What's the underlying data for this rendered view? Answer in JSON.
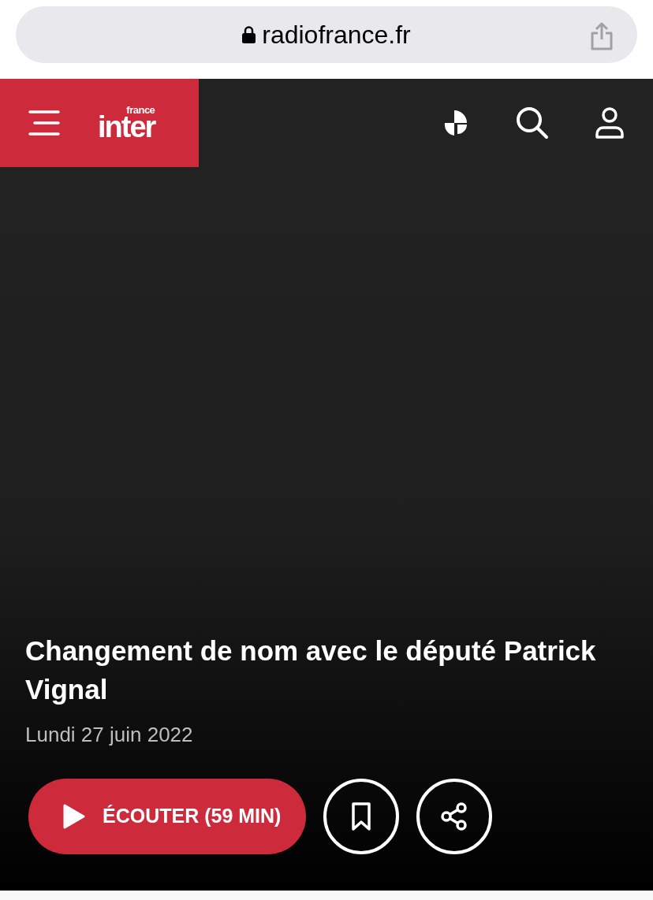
{
  "browser": {
    "url": "radiofrance.fr"
  },
  "header": {
    "logo_small": "france",
    "logo_main": "inter"
  },
  "episode": {
    "title": "Changement de nom avec le député Patrick Vignal",
    "date": "Lundi 27 juin 2022",
    "listen_label": "ÉCOUTER (59 MIN)"
  }
}
